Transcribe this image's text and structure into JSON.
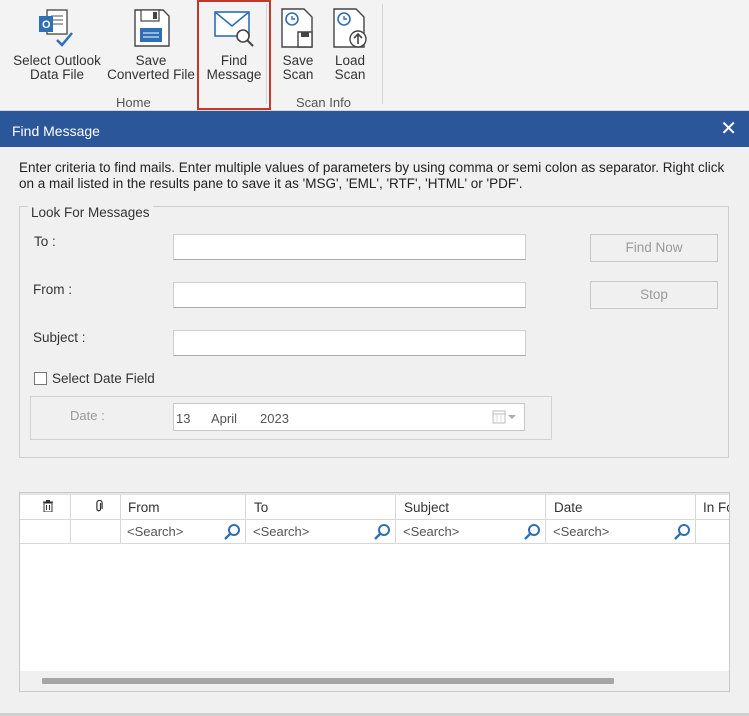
{
  "ribbon": {
    "buttons": [
      {
        "label": "Select Outlook\nData File",
        "icon": "outlook-data-file-icon"
      },
      {
        "label": "Save\nConverted File",
        "icon": "save-floppy-icon"
      },
      {
        "label": "Find\nMessage",
        "icon": "find-message-envelope-icon"
      },
      {
        "label": "Save\nScan",
        "icon": "save-scan-icon"
      },
      {
        "label": "Load\nScan",
        "icon": "load-scan-icon"
      }
    ],
    "groups": [
      "Home",
      "Scan Info"
    ]
  },
  "dialog": {
    "title": "Find Message",
    "close": "✕",
    "instructions": "Enter criteria to find mails. Enter multiple values of parameters by using comma or semi colon as separator. Right click on a mail listed in the results pane to save it as 'MSG', 'EML', 'RTF', 'HTML' or 'PDF'.",
    "look_for": {
      "legend": "Look For Messages",
      "to_label": "To :",
      "from_label": "From :",
      "subject_label": "Subject :",
      "to_value": "",
      "from_value": "",
      "subject_value": "",
      "find_now": "Find Now",
      "stop": "Stop",
      "select_date_field": "Select Date Field",
      "select_date_checked": false,
      "date_label": "Date :",
      "date": {
        "day": "13",
        "month": "April",
        "year": "2023"
      }
    },
    "grid": {
      "columns": [
        "",
        "",
        "From",
        "To",
        "Subject",
        "Date",
        "In Fo"
      ],
      "column_icons": [
        "trash-icon",
        "attachment-icon"
      ],
      "search_placeholder": "<Search>"
    }
  },
  "colors": {
    "titlebar": "#2b579a",
    "accent_icon": "#2f6fb5",
    "active_border": "#c0392b"
  }
}
